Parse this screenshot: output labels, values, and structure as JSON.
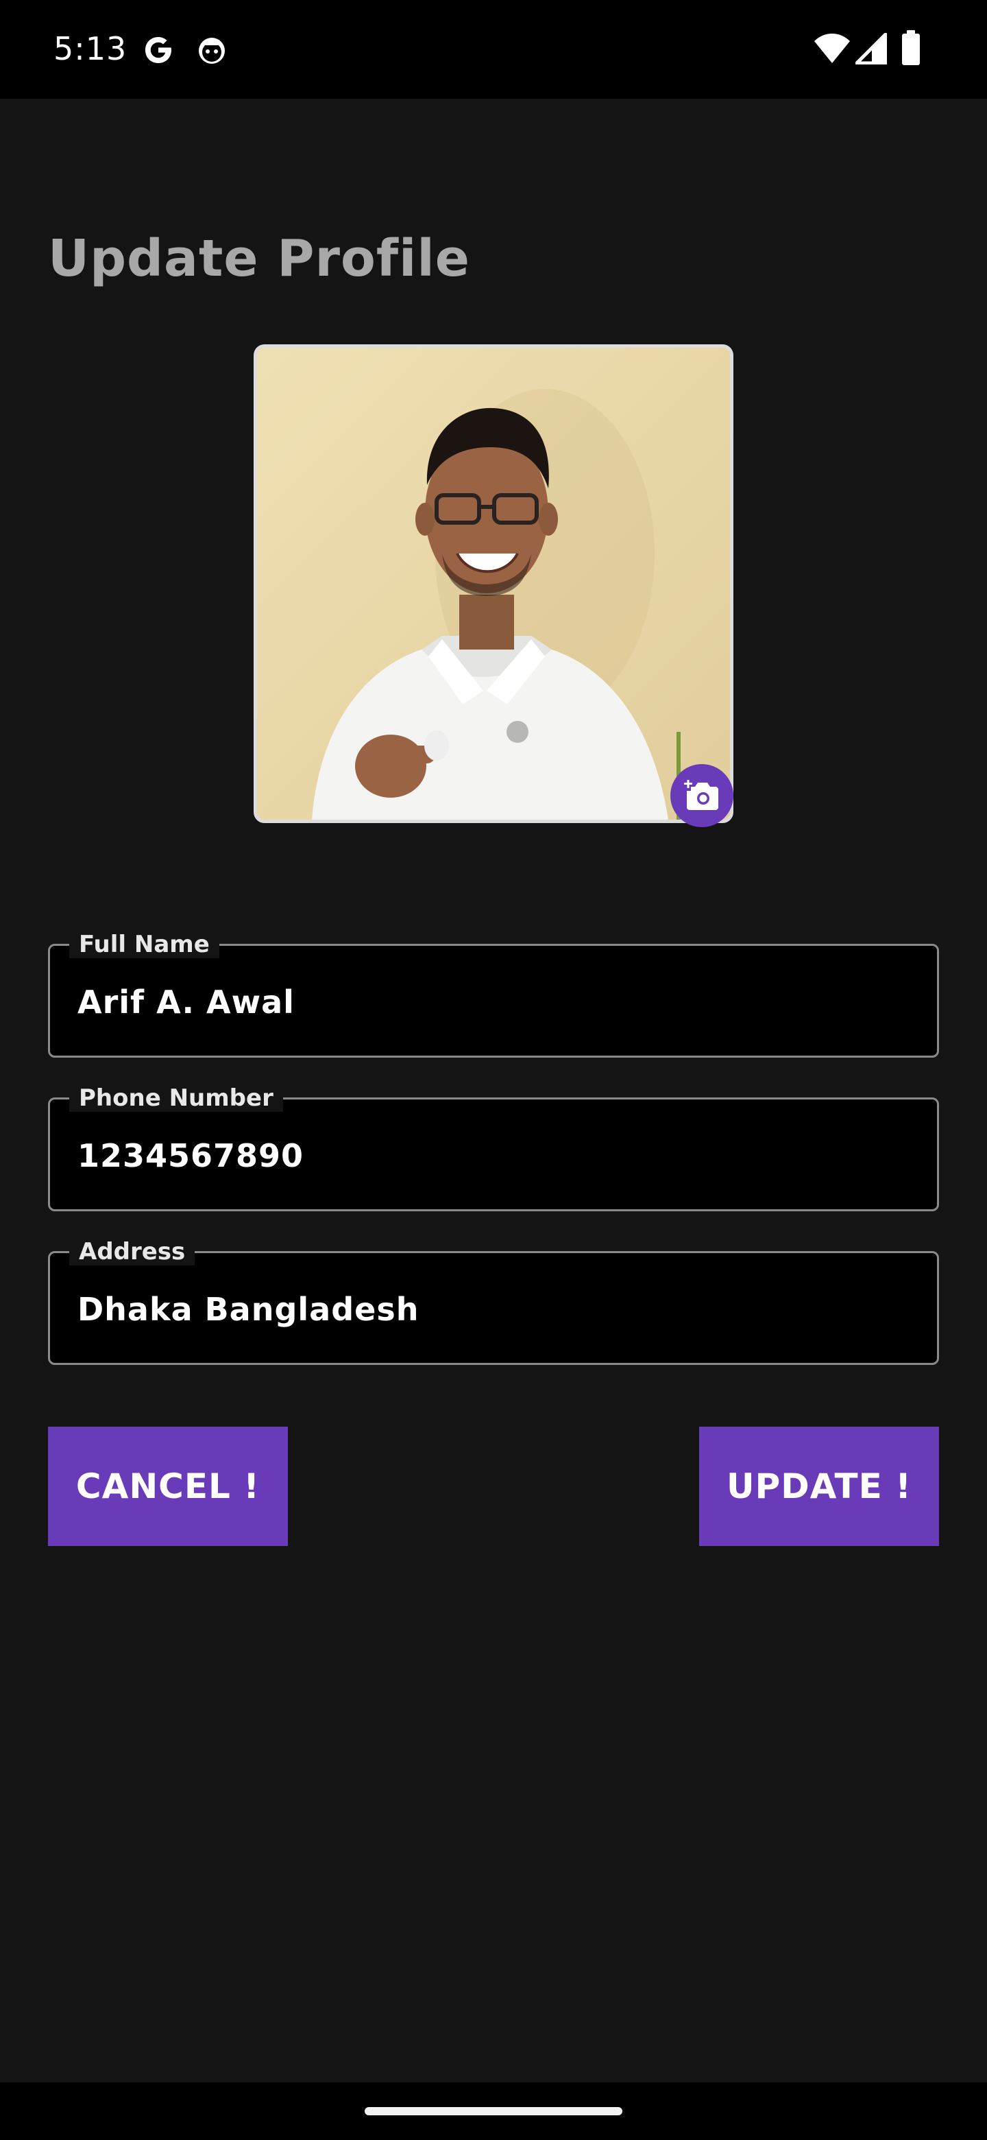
{
  "status_bar": {
    "time": "5:13",
    "icons": [
      "google-icon",
      "face-icon",
      "wifi-icon",
      "signal-icon",
      "battery-icon"
    ]
  },
  "page": {
    "title": "Update Profile"
  },
  "photo": {
    "camera_icon": "add-photo-camera-icon"
  },
  "form": {
    "full_name": {
      "label": "Full Name",
      "value": "Arif A. Awal"
    },
    "phone": {
      "label": "Phone Number",
      "value": "1234567890"
    },
    "address": {
      "label": "Address",
      "value": "Dhaka Bangladesh"
    }
  },
  "actions": {
    "cancel_label": "CANCEL !",
    "update_label": "UPDATE !"
  },
  "colors": {
    "accent": "#6a3bb8",
    "background": "#141414",
    "field_background": "#000000",
    "title": "#a8a8a8"
  }
}
